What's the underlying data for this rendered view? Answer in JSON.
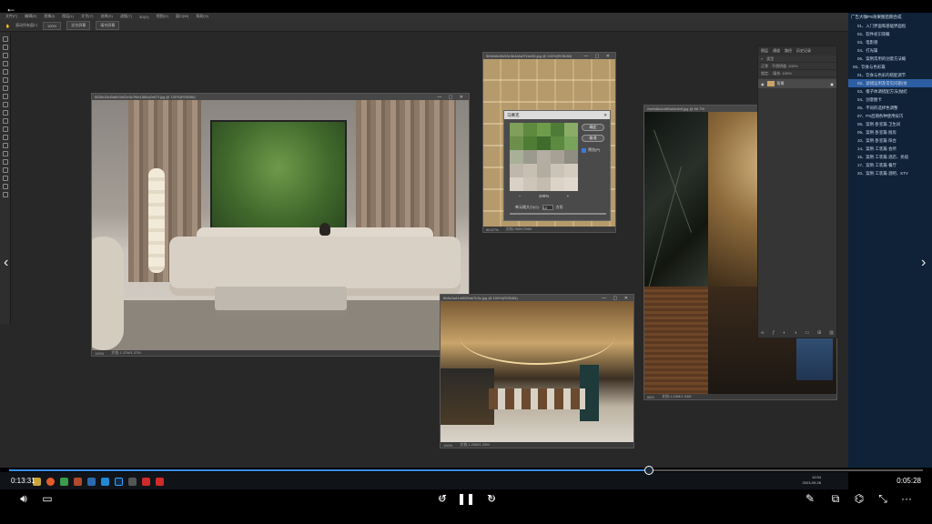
{
  "ps": {
    "menu": [
      "文件(F)",
      "编辑(E)",
      "图像(I)",
      "图层(L)",
      "文字(Y)",
      "选择(S)",
      "滤镜(T)",
      "3D(D)",
      "视图(V)",
      "窗口(W)",
      "帮助(H)"
    ],
    "options": {
      "scroll_all": "滚动所有窗口",
      "zoom": "100%",
      "fit_screen": "适合屏幕",
      "fill_screen": "填充屏幕"
    }
  },
  "docs": {
    "living": {
      "title": "6836c34d0a6b3d42e5c7f6e1886a2e67f.jpg @ 100%(RGB/8#)",
      "status_zoom": "100%",
      "status_doc": "文档:1.37M/1.37M"
    },
    "wood": {
      "title": "5b9eb6d5e53e3b3a5a7f1be35.jpg @ 100%(RGB/8#)",
      "status_zoom": "66.67%",
      "status_doc": "文档:786K/786K"
    },
    "marble": {
      "title": "2aebd6a1e8f6a0edb8.jpg @ 66.7%",
      "status_zoom": "66%",
      "status_doc": "文档:1.04M/1.04M"
    },
    "restaurant": {
      "title": "6b8c2ad1a5f0f6ab7b3c.jpg @ 100%(RGB/8#)",
      "status_zoom": "100%",
      "status_doc": "文档:1.25M/1.25M"
    }
  },
  "dialog": {
    "title": "马赛克",
    "ok": "确定",
    "cancel": "取消",
    "preview": "预览(P)",
    "zoom_value": "100%",
    "zoom_out": "−",
    "zoom_in": "+",
    "cell_label": "单元格大小(C):",
    "cell_value": "12",
    "cell_unit": "方形",
    "mosaic_colors": [
      "#7f9f5a",
      "#5d8a3e",
      "#6f9c4a",
      "#4e7c38",
      "#8aac66",
      "#6d8f4c",
      "#4f7d35",
      "#3f6b2c",
      "#5b8a40",
      "#79a25a",
      "#a8b098",
      "#9c9a8e",
      "#b4ada3",
      "#a7a195",
      "#8f8c82",
      "#bfb7ab",
      "#c7bfb2",
      "#b3aca0",
      "#cbc3b7",
      "#d4ccbf",
      "#d9d1c5",
      "#cdc5b8",
      "#c4bcaf",
      "#dbd3c8",
      "#e0d8cc"
    ]
  },
  "layers": {
    "tabs": [
      "图层",
      "通道",
      "路径",
      "历史记录"
    ],
    "kind": "类型",
    "blend": "正常",
    "opacity": "不透明度: 100%",
    "lock": "锁定:",
    "fill": "填充: 100%",
    "layer_name": "背景"
  },
  "outline": {
    "header": "广告大咖PS效果图后期合成",
    "items": [
      {
        "t": "01、入门界面和基础界面指",
        "c": "sub"
      },
      {
        "t": "02、软件初识简概",
        "c": "sub"
      },
      {
        "t": "03、电影感",
        "c": "sub"
      },
      {
        "t": "04、打光篇",
        "c": "sub"
      },
      {
        "t": "05、案例常用的创意方法概",
        "c": "sub"
      },
      {
        "t": "06、饮食与色彩篇",
        "c": "sec"
      },
      {
        "t": "01、饮食与色彩的搭配调节",
        "c": "sub"
      },
      {
        "t": "02、滤镜运用及常见问题(仿",
        "c": "hl"
      },
      {
        "t": "03、橙子体调搭配方法(抛结",
        "c": "sub"
      },
      {
        "t": "04、创意图卡",
        "c": "sub"
      },
      {
        "t": "05、不同的选择色调整",
        "c": "sub"
      },
      {
        "t": "07、PS后期各种使用技巧",
        "c": "sub"
      },
      {
        "t": "08、案例·卧室篇·卫生间",
        "c": "sub"
      },
      {
        "t": "09、案例·卧室篇·厨房",
        "c": "sub"
      },
      {
        "t": "10、案例·卧室篇·阳台",
        "c": "sub"
      },
      {
        "t": "14、案例·工装篇·会所",
        "c": "sub"
      },
      {
        "t": "15、案例·工装篇·酒店、民宿",
        "c": "sub"
      },
      {
        "t": "17、案例·工装篇·餐厅",
        "c": "sub"
      },
      {
        "t": "20、案例·工装篇·酒吧、KTV",
        "c": "sub"
      }
    ]
  },
  "taskbar": {
    "time": "12:54",
    "date": "2023-09-26"
  },
  "player": {
    "back_icon": "←",
    "prev_icon": "‹",
    "next_icon": "›",
    "current_time": "0:13:31",
    "total_time": "0:05:28",
    "progress": 0.7,
    "rewind_seconds": "10",
    "forward_seconds": "30",
    "pause_icon": "❚❚",
    "more_icon": "···",
    "accent": "#3d8ef0"
  }
}
